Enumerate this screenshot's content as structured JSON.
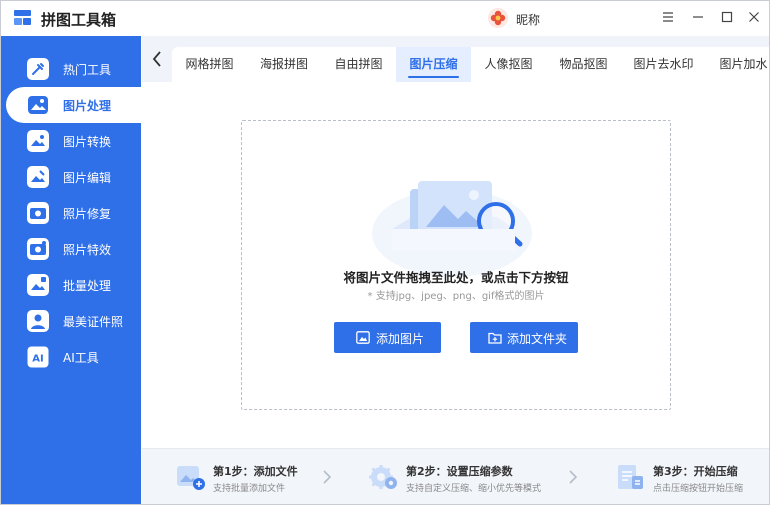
{
  "app": {
    "title": "拼图工具箱",
    "user_name": "昵称"
  },
  "sidebar": {
    "items": [
      {
        "label": "热门工具"
      },
      {
        "label": "图片处理"
      },
      {
        "label": "图片转换"
      },
      {
        "label": "图片编辑"
      },
      {
        "label": "照片修复"
      },
      {
        "label": "照片特效"
      },
      {
        "label": "批量处理"
      },
      {
        "label": "最美证件照"
      },
      {
        "label": "AI工具"
      }
    ],
    "active_index": 1
  },
  "tabs": {
    "items": [
      {
        "label": "网格拼图"
      },
      {
        "label": "海报拼图"
      },
      {
        "label": "自由拼图"
      },
      {
        "label": "图片压缩"
      },
      {
        "label": "人像抠图"
      },
      {
        "label": "物品抠图"
      },
      {
        "label": "图片去水印"
      },
      {
        "label": "图片加水"
      }
    ],
    "active_index": 3
  },
  "dropzone": {
    "text": "将图片文件拖拽至此处，或点击下方按钮",
    "hint": "* 支持jpg、jpeg、png、gif格式的图片",
    "add_image_label": "添加图片",
    "add_folder_label": "添加文件夹"
  },
  "steps": [
    {
      "title": "第1步：添加文件",
      "desc": "支持批量添加文件"
    },
    {
      "title": "第2步：设置压缩参数",
      "desc": "支持自定义压缩、缩小优先等模式"
    },
    {
      "title": "第3步：开始压缩",
      "desc": "点击压缩按钮开始压缩"
    }
  ],
  "colors": {
    "brand": "#2f6fe8",
    "tab_bg": "#f0f4fa",
    "steps_bg": "#f2f5fa"
  }
}
